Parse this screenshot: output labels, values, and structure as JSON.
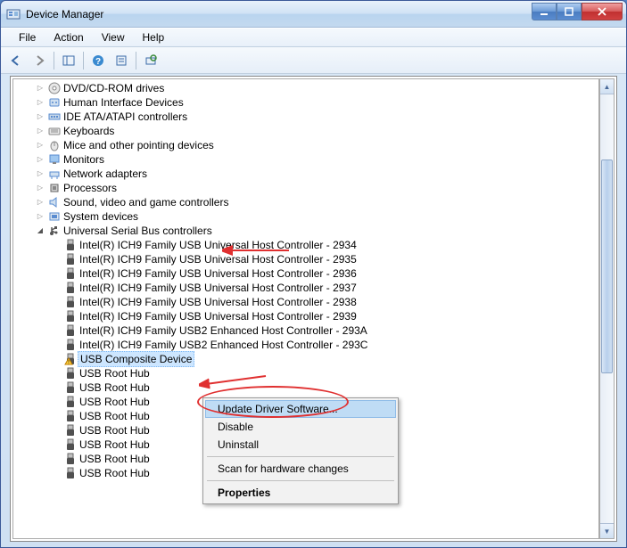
{
  "window": {
    "title": "Device Manager"
  },
  "menu": {
    "file": "File",
    "action": "Action",
    "view": "View",
    "help": "Help"
  },
  "tree": {
    "categories": [
      {
        "label": "DVD/CD-ROM drives",
        "icon": "disc"
      },
      {
        "label": "Human Interface Devices",
        "icon": "hid"
      },
      {
        "label": "IDE ATA/ATAPI controllers",
        "icon": "ide"
      },
      {
        "label": "Keyboards",
        "icon": "keyboard"
      },
      {
        "label": "Mice and other pointing devices",
        "icon": "mouse"
      },
      {
        "label": "Monitors",
        "icon": "monitor"
      },
      {
        "label": "Network adapters",
        "icon": "network"
      },
      {
        "label": "Processors",
        "icon": "cpu"
      },
      {
        "label": "Sound, video and game controllers",
        "icon": "sound"
      },
      {
        "label": "System devices",
        "icon": "system"
      }
    ],
    "usb_category": {
      "label": "Universal Serial Bus controllers"
    },
    "usb_devices": [
      {
        "label": "Intel(R) ICH9 Family USB Universal Host Controller - 2934",
        "icon": "usb"
      },
      {
        "label": "Intel(R) ICH9 Family USB Universal Host Controller - 2935",
        "icon": "usb"
      },
      {
        "label": "Intel(R) ICH9 Family USB Universal Host Controller - 2936",
        "icon": "usb"
      },
      {
        "label": "Intel(R) ICH9 Family USB Universal Host Controller - 2937",
        "icon": "usb"
      },
      {
        "label": "Intel(R) ICH9 Family USB Universal Host Controller - 2938",
        "icon": "usb"
      },
      {
        "label": "Intel(R) ICH9 Family USB Universal Host Controller - 2939",
        "icon": "usb"
      },
      {
        "label": "Intel(R) ICH9 Family USB2 Enhanced Host Controller - 293A",
        "icon": "usb"
      },
      {
        "label": "Intel(R) ICH9 Family USB2 Enhanced Host Controller - 293C",
        "icon": "usb"
      },
      {
        "label": "USB Composite Device",
        "icon": "usb-warn",
        "selected": true
      },
      {
        "label": "USB Root Hub",
        "icon": "usb"
      },
      {
        "label": "USB Root Hub",
        "icon": "usb"
      },
      {
        "label": "USB Root Hub",
        "icon": "usb"
      },
      {
        "label": "USB Root Hub",
        "icon": "usb"
      },
      {
        "label": "USB Root Hub",
        "icon": "usb"
      },
      {
        "label": "USB Root Hub",
        "icon": "usb"
      },
      {
        "label": "USB Root Hub",
        "icon": "usb"
      },
      {
        "label": "USB Root Hub",
        "icon": "usb"
      }
    ]
  },
  "context_menu": {
    "update": "Update Driver Software...",
    "disable": "Disable",
    "uninstall": "Uninstall",
    "scan": "Scan for hardware changes",
    "properties": "Properties"
  }
}
